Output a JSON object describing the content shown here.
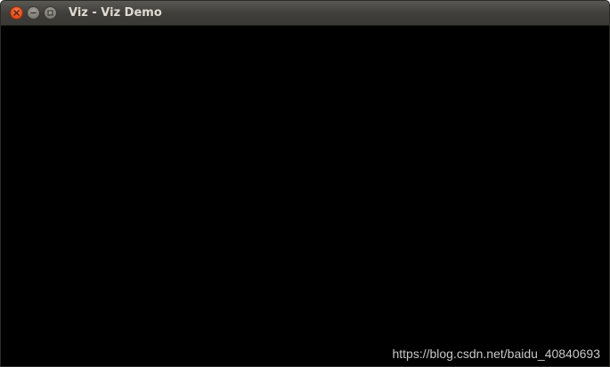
{
  "window": {
    "title": "Viz - Viz Demo",
    "controls": {
      "close_icon": "close-icon",
      "minimize_icon": "minimize-icon",
      "maximize_icon": "maximize-icon"
    }
  },
  "watermark": {
    "text": "https://blog.csdn.net/baidu_40840693"
  },
  "colors": {
    "canvas_background": "#000000",
    "titlebar": "#3e3d39",
    "close_button": "#df4b16",
    "title_text": "#dfdbd2"
  }
}
